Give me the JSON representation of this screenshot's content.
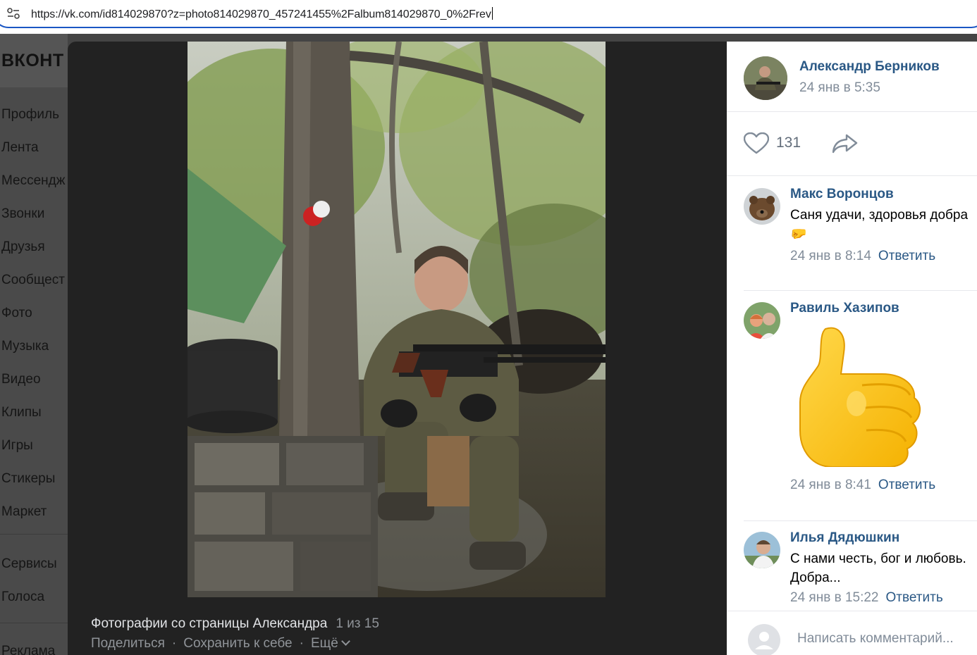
{
  "browser": {
    "url": "https://vk.com/id814029870?z=photo814029870_457241455%2Falbum814029870_0%2Frev"
  },
  "vk": {
    "logo": "ВКОНТ",
    "nav": [
      "Профиль",
      "Лента",
      "Мессендж",
      "Звонки",
      "Друзья",
      "Сообщест",
      "Фото",
      "Музыка",
      "Видео",
      "Клипы",
      "Игры",
      "Стикеры",
      "Маркет"
    ],
    "nav2": [
      "Сервисы",
      "Голоса"
    ],
    "nav3": [
      "Реклама"
    ]
  },
  "viewer": {
    "caption": "Фотографии со страницы Александра",
    "counter": "1 из 15",
    "share_label": "Поделиться",
    "save_label": "Сохранить к себе",
    "more_label": "Ещё",
    "separator": "·"
  },
  "post": {
    "author": "Александр Берников",
    "date": "24 янв в 5:35",
    "likes": "131"
  },
  "comments": [
    {
      "name": "Макс Воронцов",
      "lines": [
        "Саня удачи, здоровья добра",
        "🤛"
      ],
      "date": "24 янв в 8:14",
      "reply": "Ответить"
    },
    {
      "name": "Равиль Хазипов",
      "lines": [],
      "sticker": "thumbs-up",
      "date": "24 янв в 8:41",
      "reply": "Ответить"
    },
    {
      "name": "Илья Дядюшкин",
      "lines": [
        "С нами честь, бог и любовь.",
        "Добра..."
      ],
      "date": "24 янв в 15:22",
      "reply": "Ответить"
    }
  ],
  "comment_input": {
    "placeholder": "Написать комментарий..."
  },
  "colors": {
    "link": "#2a5885",
    "muted": "#818c99",
    "viewer_bg": "#222222",
    "url_border": "#1a56c4"
  }
}
